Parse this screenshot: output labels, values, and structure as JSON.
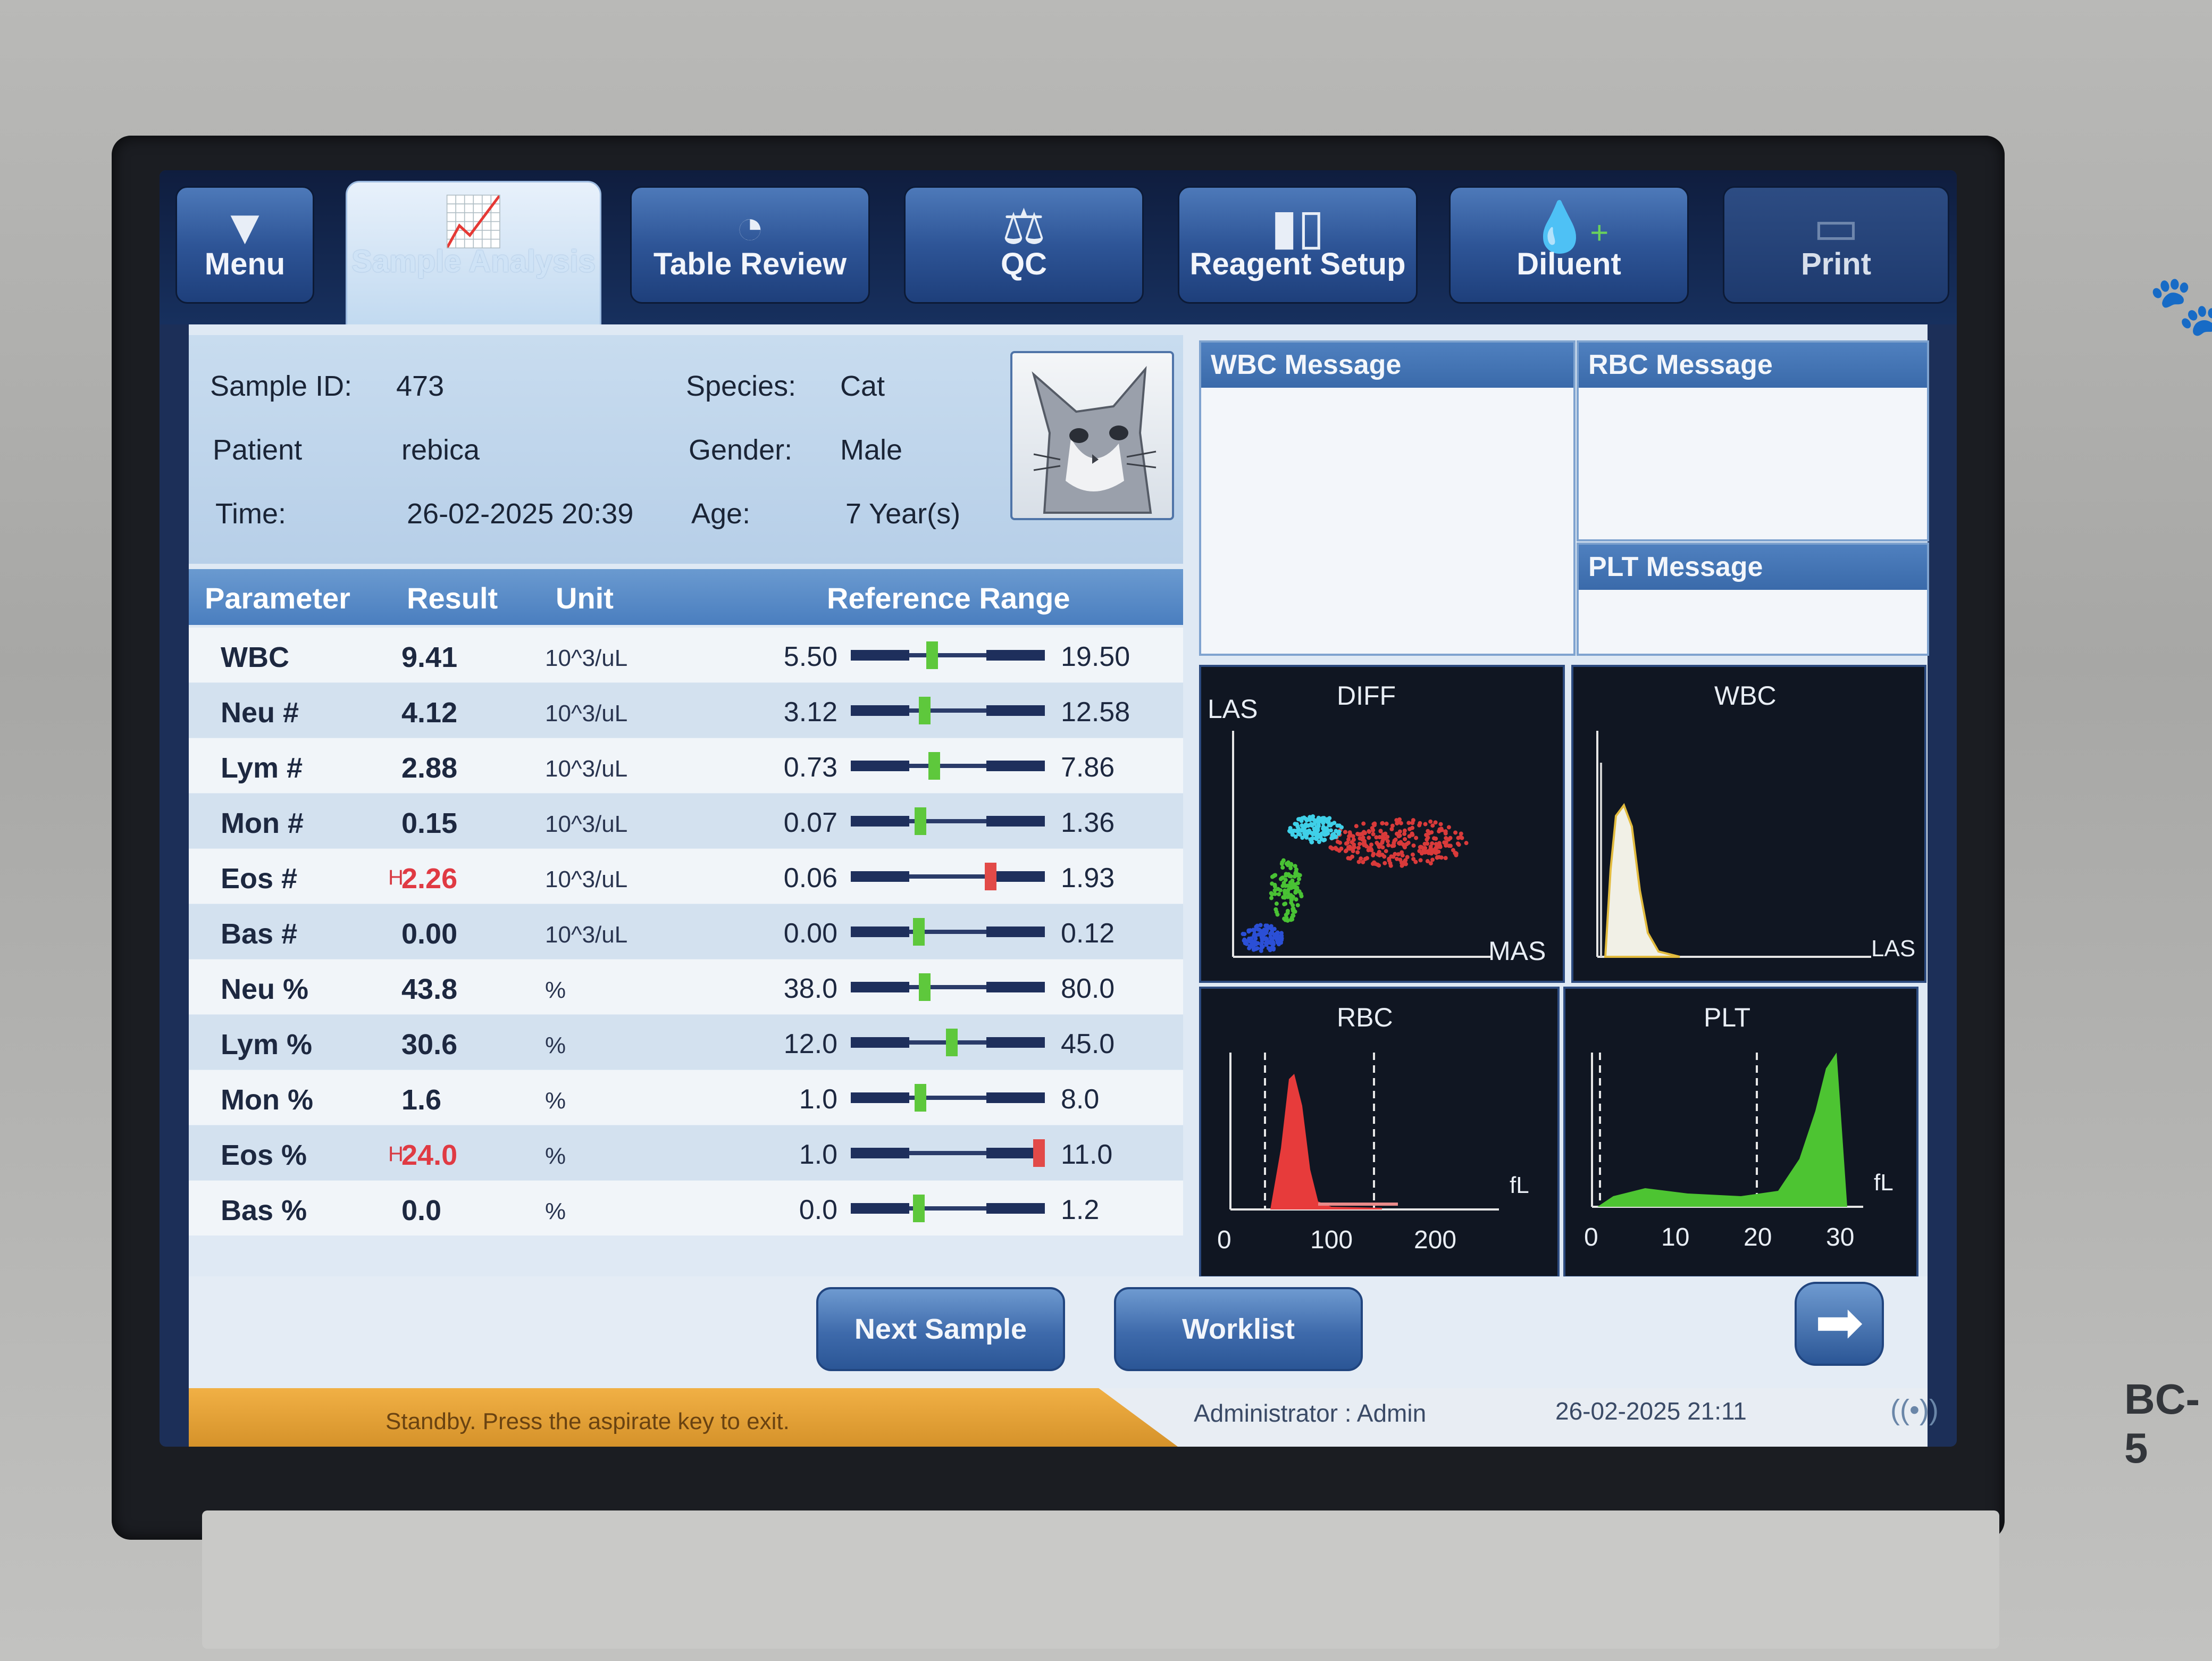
{
  "toolbar": {
    "menu": "Menu",
    "sample_analysis": "Sample Analysis",
    "table_review": "Table Review",
    "qc": "QC",
    "reagent_setup": "Reagent Setup",
    "diluent": "Diluent",
    "print": "Print"
  },
  "sample": {
    "id_label": "Sample ID:",
    "id": "473",
    "patient_label": "Patient",
    "patient": "rebica",
    "time_label": "Time:",
    "time": "26-02-2025 20:39",
    "species_label": "Species:",
    "species": "Cat",
    "gender_label": "Gender:",
    "gender": "Male",
    "age_label": "Age:",
    "age": "7 Year(s)"
  },
  "table": {
    "headers": [
      "Parameter",
      "Result",
      "Unit",
      "Reference Range"
    ],
    "rows": [
      {
        "param": "WBC",
        "flag": "",
        "result": "9.41",
        "unit": "10^3/uL",
        "low": "5.50",
        "high": "19.50",
        "position": 0.42,
        "status": "normal"
      },
      {
        "param": "Neu #",
        "flag": "",
        "result": "4.12",
        "unit": "10^3/uL",
        "low": "3.12",
        "high": "12.58",
        "position": 0.38,
        "status": "normal"
      },
      {
        "param": "Lym #",
        "flag": "",
        "result": "2.88",
        "unit": "10^3/uL",
        "low": "0.73",
        "high": "7.86",
        "position": 0.43,
        "status": "normal"
      },
      {
        "param": "Mon #",
        "flag": "",
        "result": "0.15",
        "unit": "10^3/uL",
        "low": "0.07",
        "high": "1.36",
        "position": 0.36,
        "status": "normal"
      },
      {
        "param": "Eos #",
        "flag": "H",
        "result": "2.26",
        "unit": "10^3/uL",
        "low": "0.06",
        "high": "1.93",
        "position": 0.72,
        "status": "high"
      },
      {
        "param": "Bas #",
        "flag": "",
        "result": "0.00",
        "unit": "10^3/uL",
        "low": "0.00",
        "high": "0.12",
        "position": 0.35,
        "status": "normal"
      },
      {
        "param": "Neu %",
        "flag": "",
        "result": "43.8",
        "unit": "%",
        "low": "38.0",
        "high": "80.0",
        "position": 0.38,
        "status": "normal"
      },
      {
        "param": "Lym %",
        "flag": "",
        "result": "30.6",
        "unit": "%",
        "low": "12.0",
        "high": "45.0",
        "position": 0.52,
        "status": "normal"
      },
      {
        "param": "Mon %",
        "flag": "",
        "result": "1.6",
        "unit": "%",
        "low": "1.0",
        "high": "8.0",
        "position": 0.36,
        "status": "normal"
      },
      {
        "param": "Eos %",
        "flag": "H",
        "result": "24.0",
        "unit": "%",
        "low": "1.0",
        "high": "11.0",
        "position": 0.97,
        "status": "high"
      },
      {
        "param": "Bas %",
        "flag": "",
        "result": "0.0",
        "unit": "%",
        "low": "0.0",
        "high": "1.2",
        "position": 0.35,
        "status": "normal"
      }
    ]
  },
  "messages": {
    "wbc": "WBC Message",
    "rbc": "RBC Message",
    "plt": "PLT Message"
  },
  "graphs": {
    "diff": {
      "title": "DIFF",
      "ylabel": "LAS",
      "xlabel": "MAS"
    },
    "wbc": {
      "title": "WBC",
      "xlabel": "LAS"
    },
    "rbc": {
      "title": "RBC",
      "unit": "fL",
      "ticks": [
        "0",
        "100",
        "200"
      ]
    },
    "plt": {
      "title": "PLT",
      "unit": "fL",
      "ticks": [
        "0",
        "10",
        "20",
        "30"
      ]
    }
  },
  "buttons": {
    "next_sample": "Next Sample",
    "worklist": "Worklist",
    "next_arrow": "➡"
  },
  "status": {
    "message": "Standby. Press the aspirate key to exit.",
    "user": "Administrator : Admin",
    "datetime": "26-02-2025 21:11",
    "rfid": "((•))"
  },
  "device": {
    "model": "BC-5"
  },
  "colors": {
    "accent": "#3a6aaa",
    "high": "#e03a43",
    "marker_normal": "#5ec83c"
  }
}
